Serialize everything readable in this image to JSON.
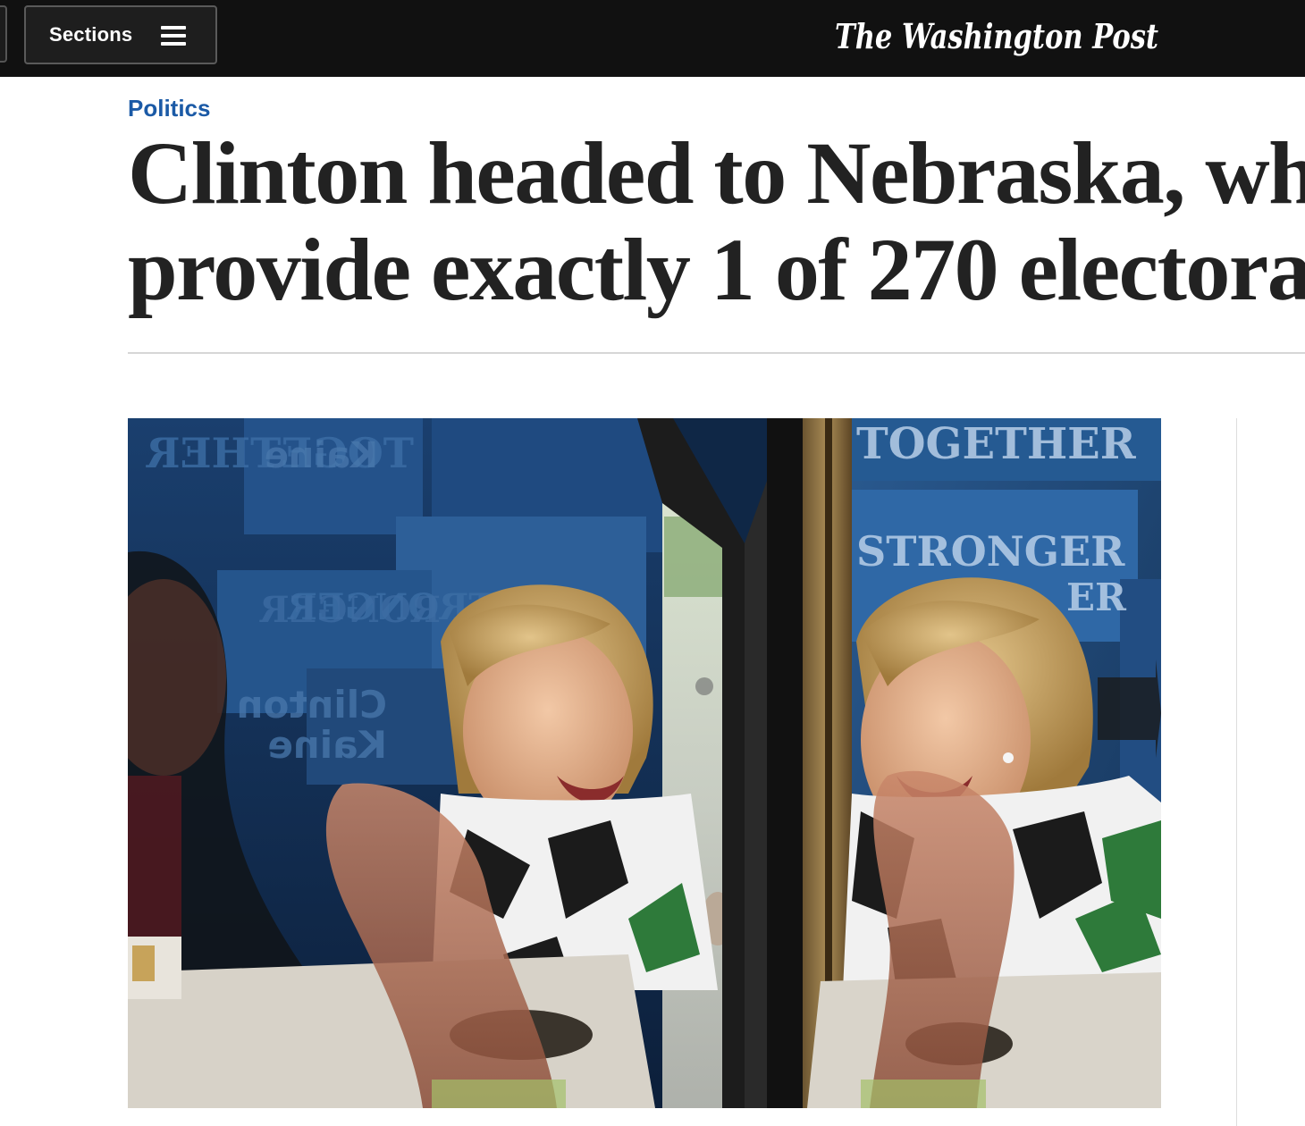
{
  "header": {
    "sections_label": "Sections",
    "menu_icon": "hamburger-icon",
    "logo_text": "The Washington Post",
    "background_color": "#111111"
  },
  "article": {
    "section": "Politics",
    "section_color": "#1b5aa6",
    "headline_line1": "Clinton headed to Nebraska, wh",
    "headline_line2": "provide exactly 1 of 270 electora"
  },
  "photo": {
    "signs": {
      "together_mirrored": "TOGETHER",
      "kaine_mirrored": "Kaine",
      "clinton_mirrored": "Clinton",
      "stronger_mirrored": "STRONGER",
      "stronger_mirrored_2": "RONGER",
      "together_right": "TOGETHER",
      "stronger_right": "STRONGER",
      "together_right_2": "ER"
    }
  }
}
